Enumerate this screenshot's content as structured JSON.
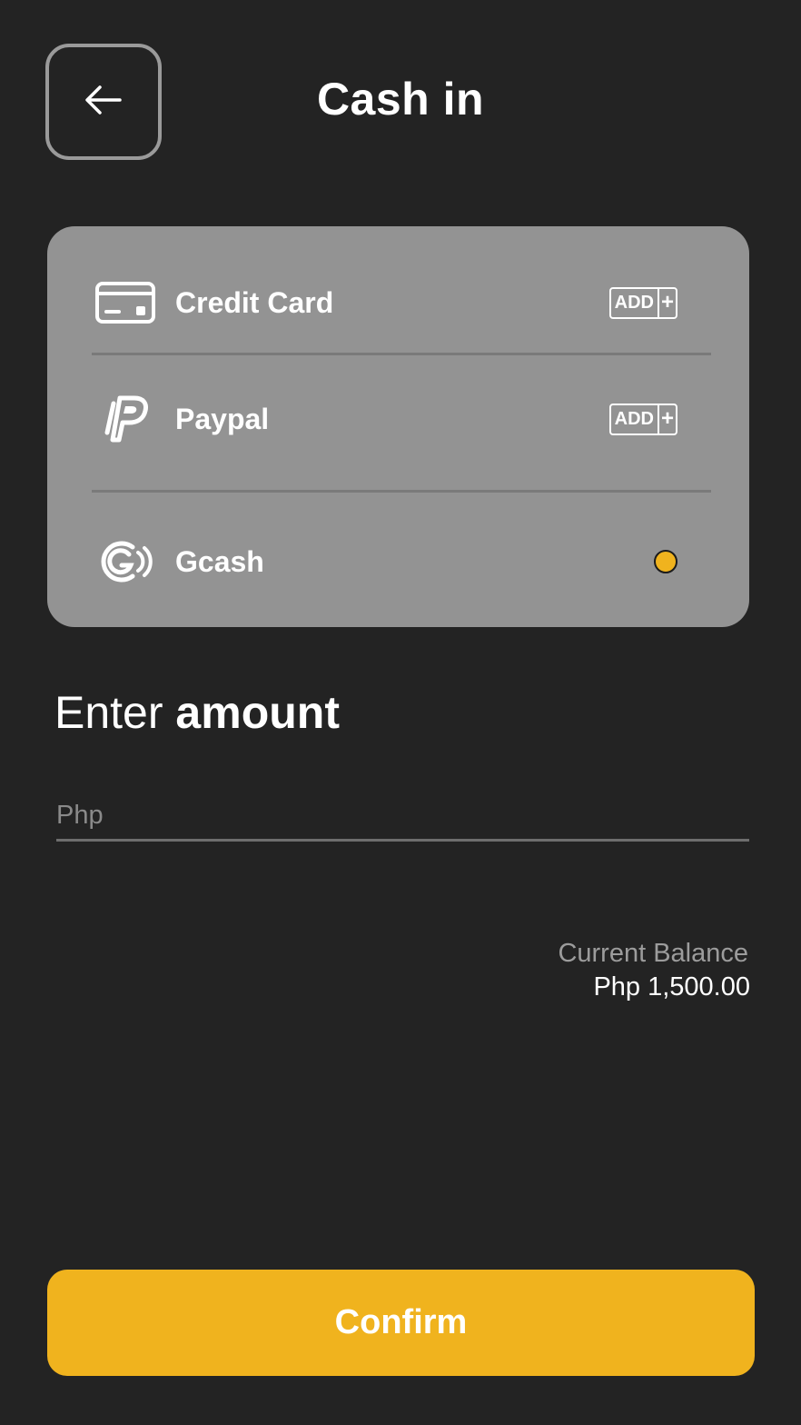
{
  "header": {
    "title": "Cash in",
    "back_icon": "arrow-left-icon"
  },
  "payment_methods": {
    "items": [
      {
        "label": "Credit Card",
        "icon": "credit-card-icon",
        "action": {
          "text": "ADD",
          "symbol": "+"
        }
      },
      {
        "label": "Paypal",
        "icon": "paypal-icon",
        "action": {
          "text": "ADD",
          "symbol": "+"
        }
      },
      {
        "label": "Gcash",
        "icon": "gcash-icon",
        "selected": true
      }
    ]
  },
  "amount": {
    "heading_light": "Enter",
    "heading_bold": "amount",
    "placeholder": "Php",
    "value": ""
  },
  "balance": {
    "label": "Current Balance",
    "value": "Php 1,500.00"
  },
  "confirm": {
    "label": "Confirm"
  },
  "colors": {
    "background": "#232323",
    "card": "#939393",
    "accent": "#f0b31e"
  }
}
